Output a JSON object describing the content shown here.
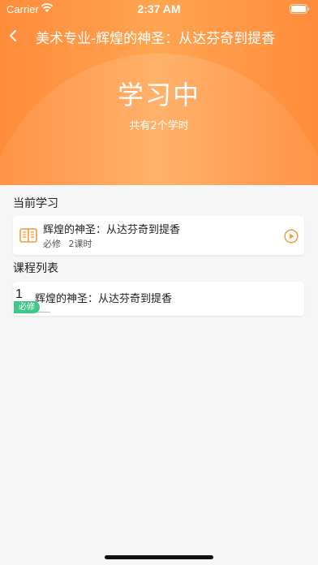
{
  "status_bar": {
    "carrier": "Carrier",
    "time": "2:37 AM"
  },
  "navbar": {
    "title": "美术专业-辉煌的神圣：从达芬奇到提香"
  },
  "hero": {
    "title": "学习中",
    "subtitle": "共有2个学时"
  },
  "current_study": {
    "section_label": "当前学习",
    "title": "辉煌的神圣：从达芬奇到提香",
    "tag": "必修",
    "hours": "2课时"
  },
  "course_list": {
    "section_label": "课程列表",
    "items": [
      {
        "index": "1",
        "title": "辉煌的神圣：从达芬奇到提香",
        "badge": "必修"
      }
    ]
  },
  "colors": {
    "accent": "#ff9040",
    "badge_green": "#3fc78a"
  }
}
